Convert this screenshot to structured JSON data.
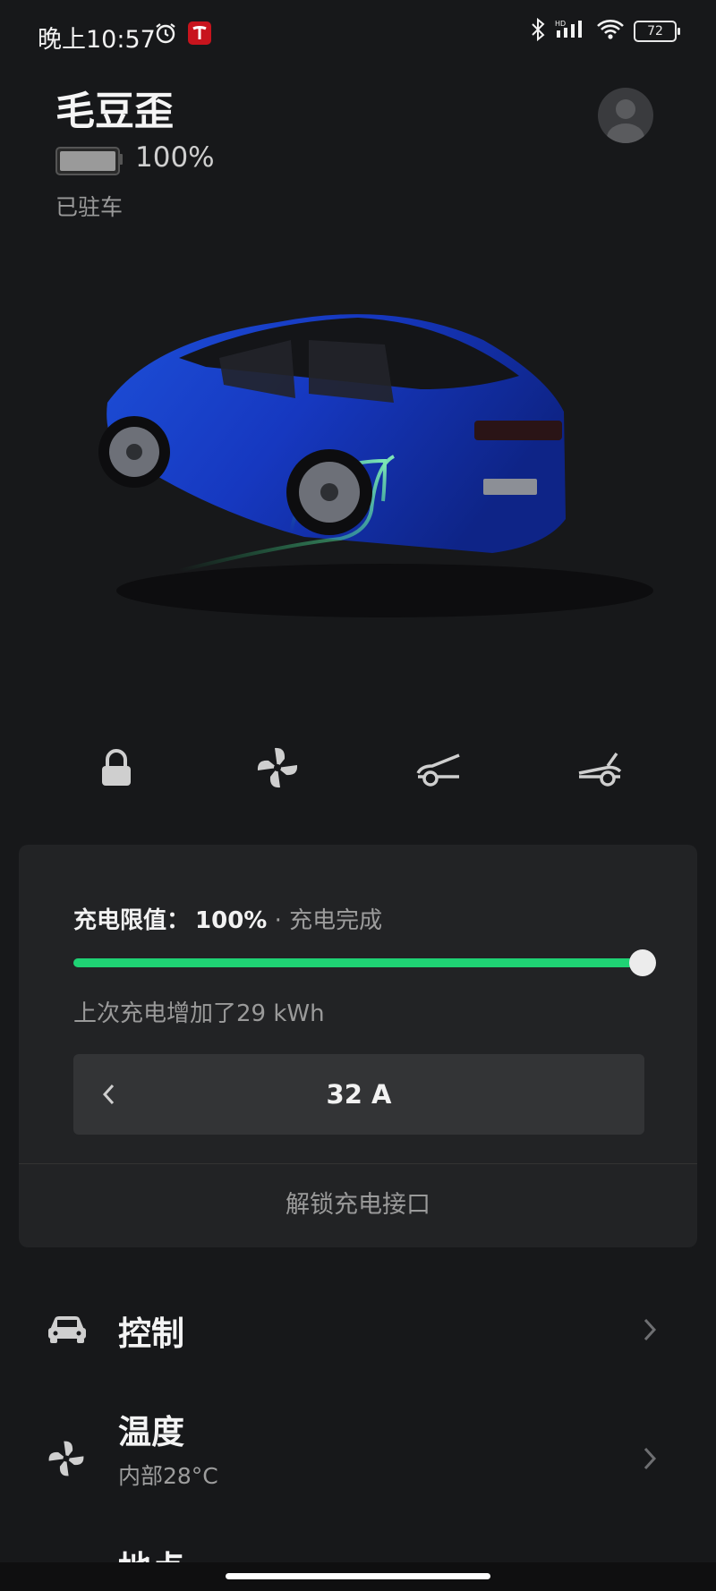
{
  "status_bar": {
    "time": "晚上10:57",
    "battery_level": "72",
    "icons": [
      "alarm-icon",
      "tesla-app-icon",
      "bluetooth-icon",
      "signal-icon",
      "wifi-icon",
      "battery-icon"
    ]
  },
  "vehicle": {
    "name": "毛豆歪",
    "battery_percent_label": "100%",
    "battery_fill": 1.0,
    "state": "已驻车"
  },
  "quick_controls": [
    {
      "name": "lock-button",
      "icon": "lock-icon"
    },
    {
      "name": "fan-button",
      "icon": "fan-icon"
    },
    {
      "name": "frunk-button",
      "icon": "frunk-icon"
    },
    {
      "name": "trunk-button",
      "icon": "trunk-icon"
    }
  ],
  "charging": {
    "limit_label": "充电限值：",
    "limit_value": "100%",
    "separator": " · ",
    "status": "充电完成",
    "slider_fraction": 1.0,
    "last_session": "上次充电增加了29 kWh",
    "current": "32 A",
    "unlock_port_label": "解锁充电接口",
    "accent_color": "#1fd274"
  },
  "menu": {
    "controls": {
      "title": "控制",
      "icon": "car-icon"
    },
    "climate": {
      "title": "温度",
      "subtitle": "内部28°C",
      "icon": "fan-icon"
    },
    "location": {
      "title": "地点"
    }
  }
}
